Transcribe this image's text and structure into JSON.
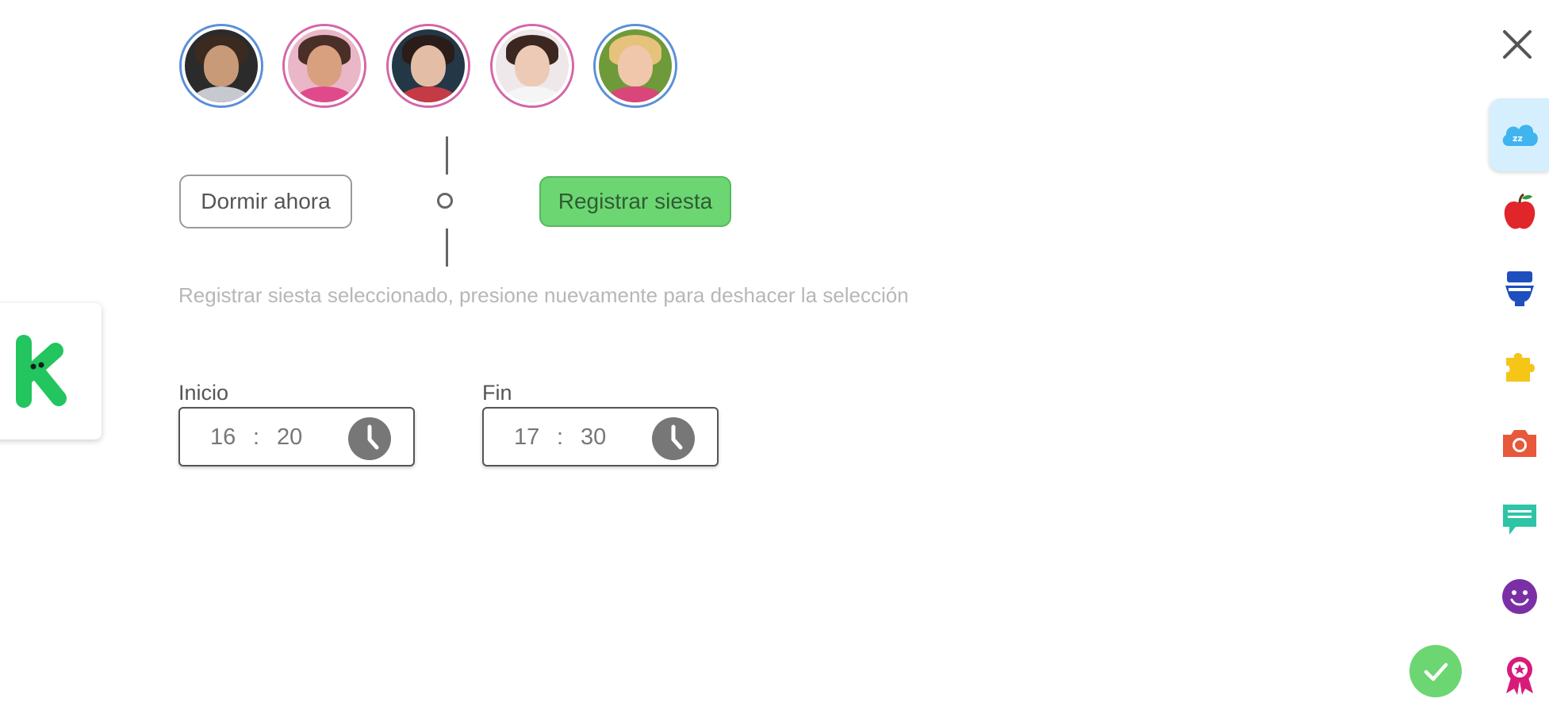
{
  "children": [
    {
      "name": "child-avatar-1",
      "ring": "blue"
    },
    {
      "name": "child-avatar-2",
      "ring": "pink"
    },
    {
      "name": "child-avatar-3",
      "ring": "pink"
    },
    {
      "name": "child-avatar-4",
      "ring": "pink"
    },
    {
      "name": "child-avatar-5",
      "ring": "blue"
    }
  ],
  "actions": {
    "sleep_now_label": "Dormir ahora",
    "register_nap_label": "Registrar siesta",
    "divider_label": "o",
    "hint": "Registrar siesta seleccionado, presione nuevamente para deshacer la selección"
  },
  "time": {
    "start": {
      "label": "Inicio",
      "hours": "16",
      "separator": ":",
      "minutes": "20"
    },
    "end": {
      "label": "Fin",
      "hours": "17",
      "separator": ":",
      "minutes": "30"
    }
  },
  "sidebar": {
    "items": [
      {
        "icon": "sleep-cloud-icon",
        "active": true
      },
      {
        "icon": "apple-icon",
        "active": false
      },
      {
        "icon": "toilet-icon",
        "active": false
      },
      {
        "icon": "puzzle-icon",
        "active": false
      },
      {
        "icon": "camera-icon",
        "active": false
      },
      {
        "icon": "message-icon",
        "active": false
      },
      {
        "icon": "smiley-icon",
        "active": false
      },
      {
        "icon": "award-icon",
        "active": false
      }
    ]
  },
  "logo": {
    "letter": "K"
  },
  "colors": {
    "primary_green": "#6cd673",
    "logo_green": "#22c55e",
    "active_tab_bg": "#d6efff",
    "avatar_blue_ring": "#5b8fd8",
    "avatar_pink_ring": "#d466a8"
  }
}
